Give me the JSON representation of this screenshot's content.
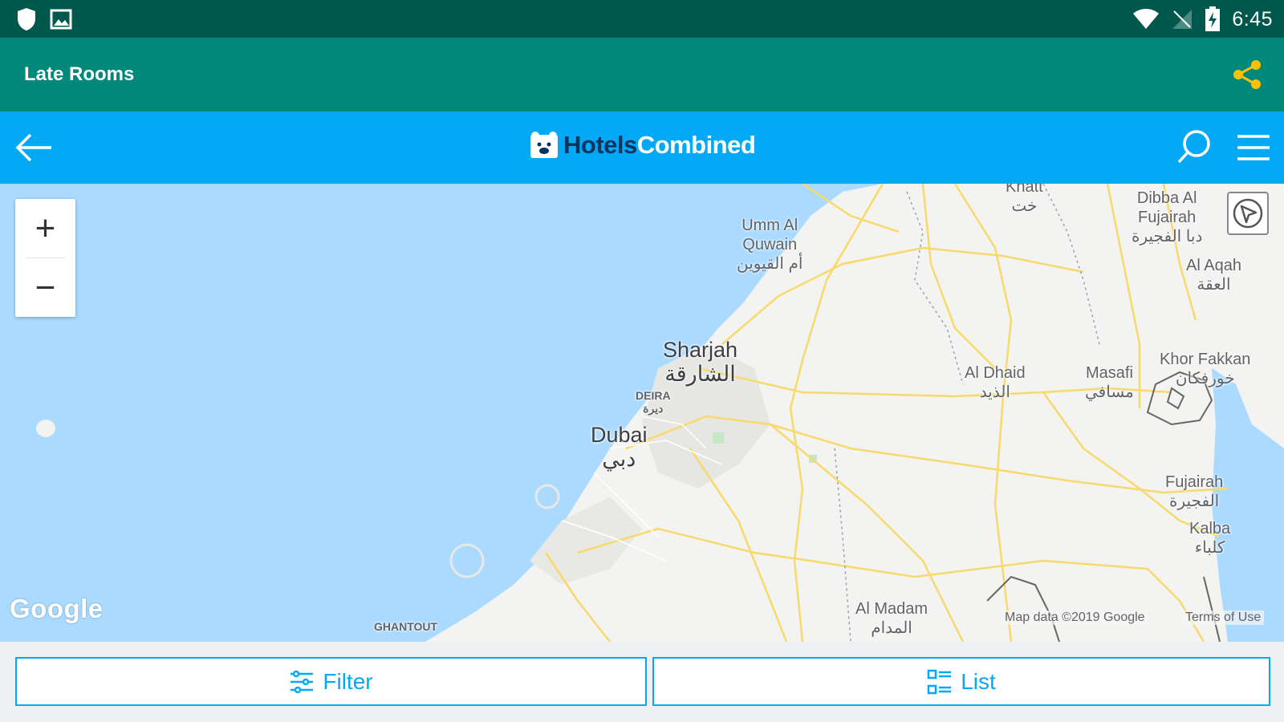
{
  "status_bar": {
    "time": "6:45",
    "icons": [
      "shield-icon",
      "image-icon",
      "wifi-icon",
      "no-signal-icon",
      "battery-charging-icon"
    ]
  },
  "app_bar": {
    "title": "Late Rooms",
    "share_icon": "share-icon",
    "accent_color": "#ffc107"
  },
  "site_header": {
    "brand_part1": "Hotels",
    "brand_part2": "Combined",
    "back_icon": "arrow-left-icon",
    "search_icon": "search-icon",
    "menu_icon": "hamburger-menu-icon",
    "color": "#03a9f4"
  },
  "map": {
    "zoom_in": "+",
    "zoom_out": "−",
    "google": "Google",
    "attribution": "Map data ©2019 Google",
    "terms": "Terms of Use",
    "labels": {
      "khatt_en": "Khatt",
      "khatt_ar": "خت",
      "dibba_en1": "Dibba Al",
      "dibba_en2": "Fujairah",
      "dibba_ar": "دبا الفجيرة",
      "umm_en1": "Umm Al",
      "umm_en2": "Quwain",
      "umm_ar": "أم القيوين",
      "aqah_en": "Al Aqah",
      "aqah_ar": "العقة",
      "sharjah_en": "Sharjah",
      "sharjah_ar": "الشارقة",
      "khor_en": "Khor Fakkan",
      "khor_ar": "خورفكان",
      "dhaid_en": "Al Dhaid",
      "dhaid_ar": "الذيد",
      "masafi_en": "Masafi",
      "masafi_ar": "مسافي",
      "deira_en": "DEIRA",
      "deira_ar": "ديرة",
      "dubai_en": "Dubai",
      "dubai_ar": "دبي",
      "fujairah_en": "Fujairah",
      "fujairah_ar": "الفجيرة",
      "kalba_en": "Kalba",
      "kalba_ar": "كلباء",
      "madam_en": "Al Madam",
      "madam_ar": "المدام",
      "ghantout": "GHANTOUT"
    }
  },
  "actions": {
    "filter": "Filter",
    "list": "List"
  }
}
